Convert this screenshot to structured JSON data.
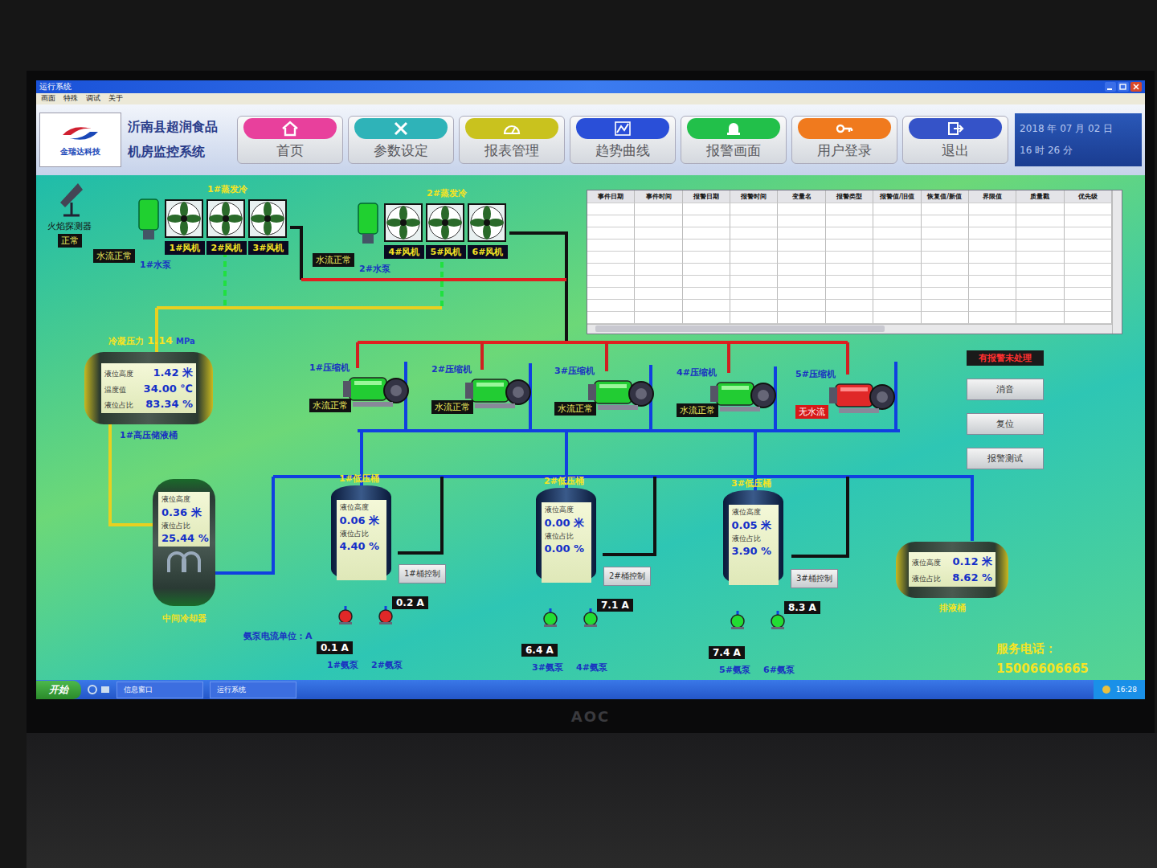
{
  "window": {
    "title": "运行系统",
    "menu": [
      "画面",
      "特殊",
      "调试",
      "关于"
    ]
  },
  "header": {
    "logo_text": "金瑞达科技",
    "company": "沂南县超润食品",
    "system": "机房监控系统",
    "date": "2018 年 07 月 02 日",
    "time": "16 时 26 分"
  },
  "nav": [
    {
      "label": "首页",
      "color": "#e8409c"
    },
    {
      "label": "参数设定",
      "color": "#2fb3b8"
    },
    {
      "label": "报表管理",
      "color": "#c9c21e"
    },
    {
      "label": "趋势曲线",
      "color": "#2a4fd8"
    },
    {
      "label": "报警画面",
      "color": "#22c04a"
    },
    {
      "label": "用户登录",
      "color": "#f07a1e"
    },
    {
      "label": "退出",
      "color": "#3553c8"
    }
  ],
  "flame_detector": {
    "label": "火焰探测器",
    "status": "正常"
  },
  "evaporators": [
    {
      "title": "1#蒸发冷",
      "pump": "1#水泵",
      "flow": "水流正常",
      "fans": [
        "1#风机",
        "2#风机",
        "3#风机"
      ]
    },
    {
      "title": "2#蒸发冷",
      "pump": "2#水泵",
      "flow": "水流正常",
      "fans": [
        "4#风机",
        "5#风机",
        "6#风机"
      ]
    }
  ],
  "condensing_pressure": {
    "label": "冷凝压力",
    "value": "1.14",
    "unit": "MPa"
  },
  "hp_receiver": {
    "name": "1#高压储液桶",
    "readings": [
      {
        "label": "液位高度",
        "value": "1.42",
        "unit": "米"
      },
      {
        "label": "温度值",
        "value": "34.00",
        "unit": "℃"
      },
      {
        "label": "液位占比",
        "value": "83.34",
        "unit": "%"
      }
    ]
  },
  "alarm_table": {
    "columns": [
      "事件日期",
      "事件时间",
      "报警日期",
      "报警时间",
      "变量名",
      "报警类型",
      "报警值/旧值",
      "恢复值/新值",
      "界限值",
      "质量戳",
      "优先级"
    ]
  },
  "compressors": [
    {
      "name": "1#压缩机",
      "status": "水流正常",
      "fault": false
    },
    {
      "name": "2#压缩机",
      "status": "水流正常",
      "fault": false
    },
    {
      "name": "3#压缩机",
      "status": "水流正常",
      "fault": false
    },
    {
      "name": "4#压缩机",
      "status": "水流正常",
      "fault": false
    },
    {
      "name": "5#压缩机",
      "status": "无水流",
      "fault": true
    }
  ],
  "alarm_panel": {
    "notice": "有报警未处理",
    "buttons": [
      "消音",
      "复位",
      "报警测试"
    ]
  },
  "intercooler": {
    "name": "中间冷却器",
    "readings": [
      {
        "label": "液位高度",
        "value": "0.36",
        "unit": "米"
      },
      {
        "label": "液位占比",
        "value": "25.44",
        "unit": "%"
      }
    ]
  },
  "lp_tanks": [
    {
      "name": "1#低压桶",
      "control": "1#桶控制",
      "readings": [
        {
          "label": "液位高度",
          "value": "0.06",
          "unit": "米"
        },
        {
          "label": "液位占比",
          "value": "4.40",
          "unit": "%"
        }
      ],
      "pumps": [
        {
          "name": "1#氨泵",
          "current": "0.1",
          "unit": "A",
          "running": false
        },
        {
          "name": "2#氨泵",
          "current": "0.2",
          "unit": "A",
          "running": false
        }
      ]
    },
    {
      "name": "2#低压桶",
      "control": "2#桶控制",
      "readings": [
        {
          "label": "液位高度",
          "value": "0.00",
          "unit": "米"
        },
        {
          "label": "液位占比",
          "value": "0.00",
          "unit": "%"
        }
      ],
      "pumps": [
        {
          "name": "3#氨泵",
          "current": "6.4",
          "unit": "A",
          "running": true
        },
        {
          "name": "4#氨泵",
          "current": "7.1",
          "unit": "A",
          "running": true
        }
      ]
    },
    {
      "name": "3#低压桶",
      "control": "3#桶控制",
      "readings": [
        {
          "label": "液位高度",
          "value": "0.05",
          "unit": "米"
        },
        {
          "label": "液位占比",
          "value": "3.90",
          "unit": "%"
        }
      ],
      "pumps": [
        {
          "name": "5#氨泵",
          "current": "7.4",
          "unit": "A",
          "running": true
        },
        {
          "name": "6#氨泵",
          "current": "8.3",
          "unit": "A",
          "running": true
        }
      ]
    }
  ],
  "pump_unit_note": "氨泵电流单位：A",
  "drain_tank": {
    "name": "排液桶",
    "readings": [
      {
        "label": "液位高度",
        "value": "0.12",
        "unit": "米"
      },
      {
        "label": "液位占比",
        "value": "8.62",
        "unit": "%"
      }
    ]
  },
  "service": {
    "label": "服务电话：",
    "phone": "15006606665"
  },
  "taskbar": {
    "start": "开始",
    "items": [
      "信息窗口",
      "运行系统"
    ],
    "clock": "16:28"
  },
  "monitor": {
    "brand": "AOC"
  }
}
